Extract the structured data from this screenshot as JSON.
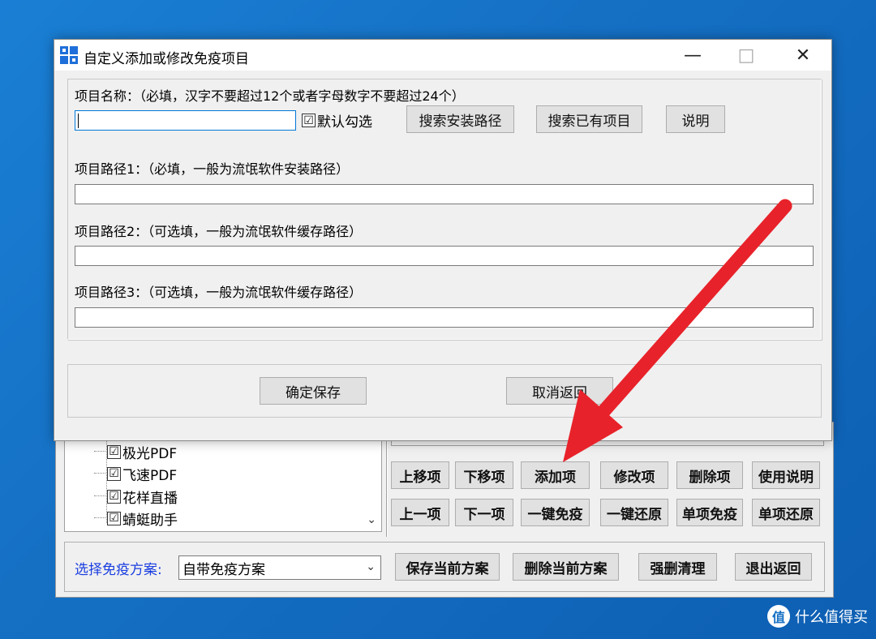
{
  "dialog": {
    "title": "自定义添加或修改免疫项目",
    "window_controls": {
      "minimize": "—",
      "maximize": "□",
      "close": "✕"
    },
    "name_label": "项目名称：（必填，汉字不要超过12个或者字母数字不要超过24个）",
    "name_value": "",
    "default_check_label": "默认勾选",
    "default_checked": "☑",
    "search_install_button": "搜索安装路径",
    "search_existing_button": "搜索已有项目",
    "help_button": "说明",
    "path1_label": "项目路径1：（必填，一般为流氓软件安装路径）",
    "path1_value": "",
    "path2_label": "项目路径2：（可选填，一般为流氓软件缓存路径）",
    "path2_value": "",
    "path3_label": "项目路径3：（可选填，一般为流氓软件缓存路径）",
    "path3_value": "",
    "confirm_button": "确定保存",
    "cancel_button": "取消返回"
  },
  "main": {
    "tree_items": [
      {
        "label": "极光PDF",
        "checked": "☑"
      },
      {
        "label": "飞速PDF",
        "checked": "☑"
      },
      {
        "label": "花样直播",
        "checked": "☑"
      },
      {
        "label": "蜻蜓助手",
        "checked": "☑"
      }
    ],
    "buttons_row1": [
      "上移项",
      "下移项",
      "添加项",
      "修改项",
      "删除项",
      "使用说明"
    ],
    "buttons_row2": [
      "上一项",
      "下一项",
      "一键免疫",
      "一键还原",
      "单项免疫",
      "单项还原"
    ],
    "scheme_label": "选择免疫方案:",
    "scheme_selected": "自带免疫方案",
    "save_scheme_button": "保存当前方案",
    "delete_scheme_button": "删除当前方案",
    "force_clean_button": "强删清理",
    "exit_button": "退出返回"
  },
  "annotation": {
    "arrow_color": "#e8222a"
  },
  "watermark": {
    "logo": "值",
    "text": "什么值得买"
  },
  "colors": {
    "desktop": "#1570c4",
    "scheme_label": "#1a3ee0",
    "focus": "#0078d7"
  }
}
